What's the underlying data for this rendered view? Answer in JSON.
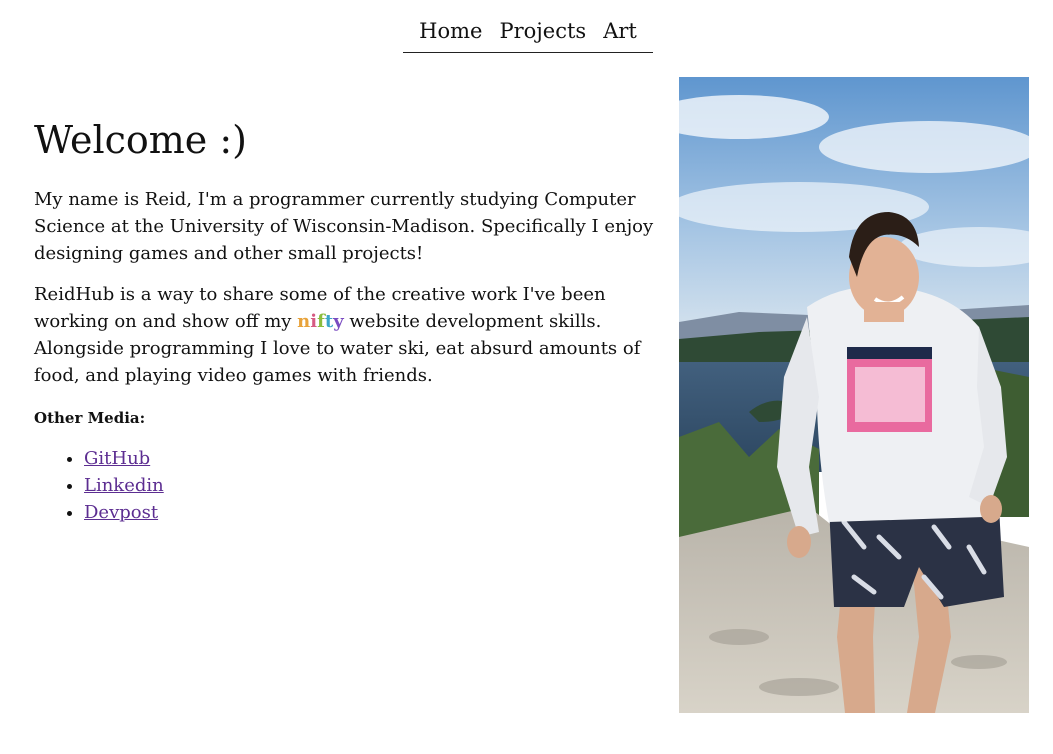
{
  "nav": {
    "items": [
      {
        "label": "Home"
      },
      {
        "label": "Projects"
      },
      {
        "label": "Art"
      }
    ]
  },
  "main": {
    "title": "Welcome :)",
    "intro": "My name is Reid, I'm a programmer currently studying Computer Science at the University of Wisconsin-Madison. Specifically I enjoy designing games and other small projects!",
    "second_para": {
      "before": "ReidHub is a way to share some of the creative work I've been working on and show off my ",
      "highlight": "nifty",
      "after": " website development skills. Alongside programming I love to water ski, eat absurd amounts of food, and playing video games with friends."
    },
    "highlight_colors": [
      "#e8a33b",
      "#d65b83",
      "#8bbd3e",
      "#3aa6c9",
      "#7a4bc1"
    ],
    "other_media_heading": "Other Media:",
    "links": [
      {
        "label": "GitHub"
      },
      {
        "label": "Linkedin"
      },
      {
        "label": "Devpost"
      }
    ]
  },
  "photo": {
    "subject": "person-in-hoodie-at-lake"
  },
  "colors": {
    "link": "#5c2d91",
    "text": "#111111",
    "background": "#ffffff"
  }
}
